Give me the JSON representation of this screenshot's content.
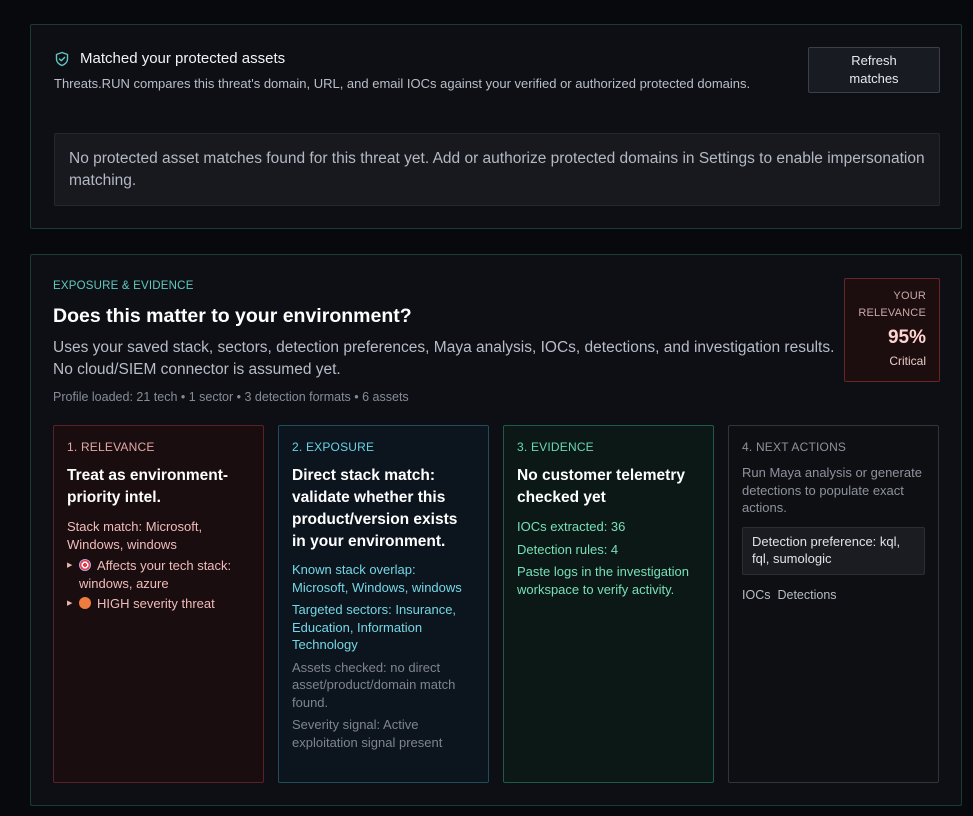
{
  "assets": {
    "title": "Matched your protected assets",
    "description": "Threats.RUN compares this threat's domain, URL, and email IOCs against your verified or authorized protected domains.",
    "refresh_label": "Refresh matches",
    "no_match_text": "No protected asset matches found for this threat yet. Add or authorize protected domains in Settings to enable impersonation matching.",
    "icon": "shield-check-icon"
  },
  "exposure": {
    "eyebrow": "EXPOSURE & EVIDENCE",
    "title": "Does this matter to your environment?",
    "description": "Uses your saved stack, sectors, detection preferences, Maya analysis, IOCs, detections, and investigation results. No cloud/SIEM connector is assumed yet.",
    "profile_line": "Profile loaded: 21 tech • 1 sector • 3 detection formats • 6 assets",
    "relevance": {
      "label_line1": "YOUR",
      "label_line2": "RELEVANCE",
      "percent": "95%",
      "level": "Critical",
      "color": "#6a2529"
    },
    "cards": {
      "relevance": {
        "step": "1. RELEVANCE",
        "title": "Treat as environment-priority intel.",
        "stack_match": "Stack match: Microsoft, Windows, windows",
        "bullet1": "Affects your tech stack: windows, azure",
        "bullet2": "HIGH severity threat"
      },
      "exposure": {
        "step": "2. EXPOSURE",
        "title": "Direct stack match: validate whether this product/version exists in your environment.",
        "overlap": "Known stack overlap: Microsoft, Windows, windows",
        "sectors": "Targeted sectors: Insurance, Education, Information Technology",
        "assets": "Assets checked: no direct asset/product/domain match found.",
        "severity": "Severity signal: Active exploitation signal present"
      },
      "evidence": {
        "step": "3. EVIDENCE",
        "title": "No customer telemetry checked yet",
        "iocs": "IOCs extracted: 36",
        "rules": "Detection rules: 4",
        "paste": "Paste logs in the investigation workspace to verify activity."
      },
      "actions": {
        "step": "4. NEXT ACTIONS",
        "text": "Run Maya analysis or generate detections to populate exact actions.",
        "preference": "Detection preference: kql, fql, sumologic",
        "link_iocs": "IOCs",
        "link_detections": "Detections"
      }
    }
  },
  "colors": {
    "accent_teal": "#5fc8c0",
    "relevance_red": "#5a2227",
    "exposure_cyan": "#1f4d5d",
    "evidence_green": "#1f5a4a"
  }
}
